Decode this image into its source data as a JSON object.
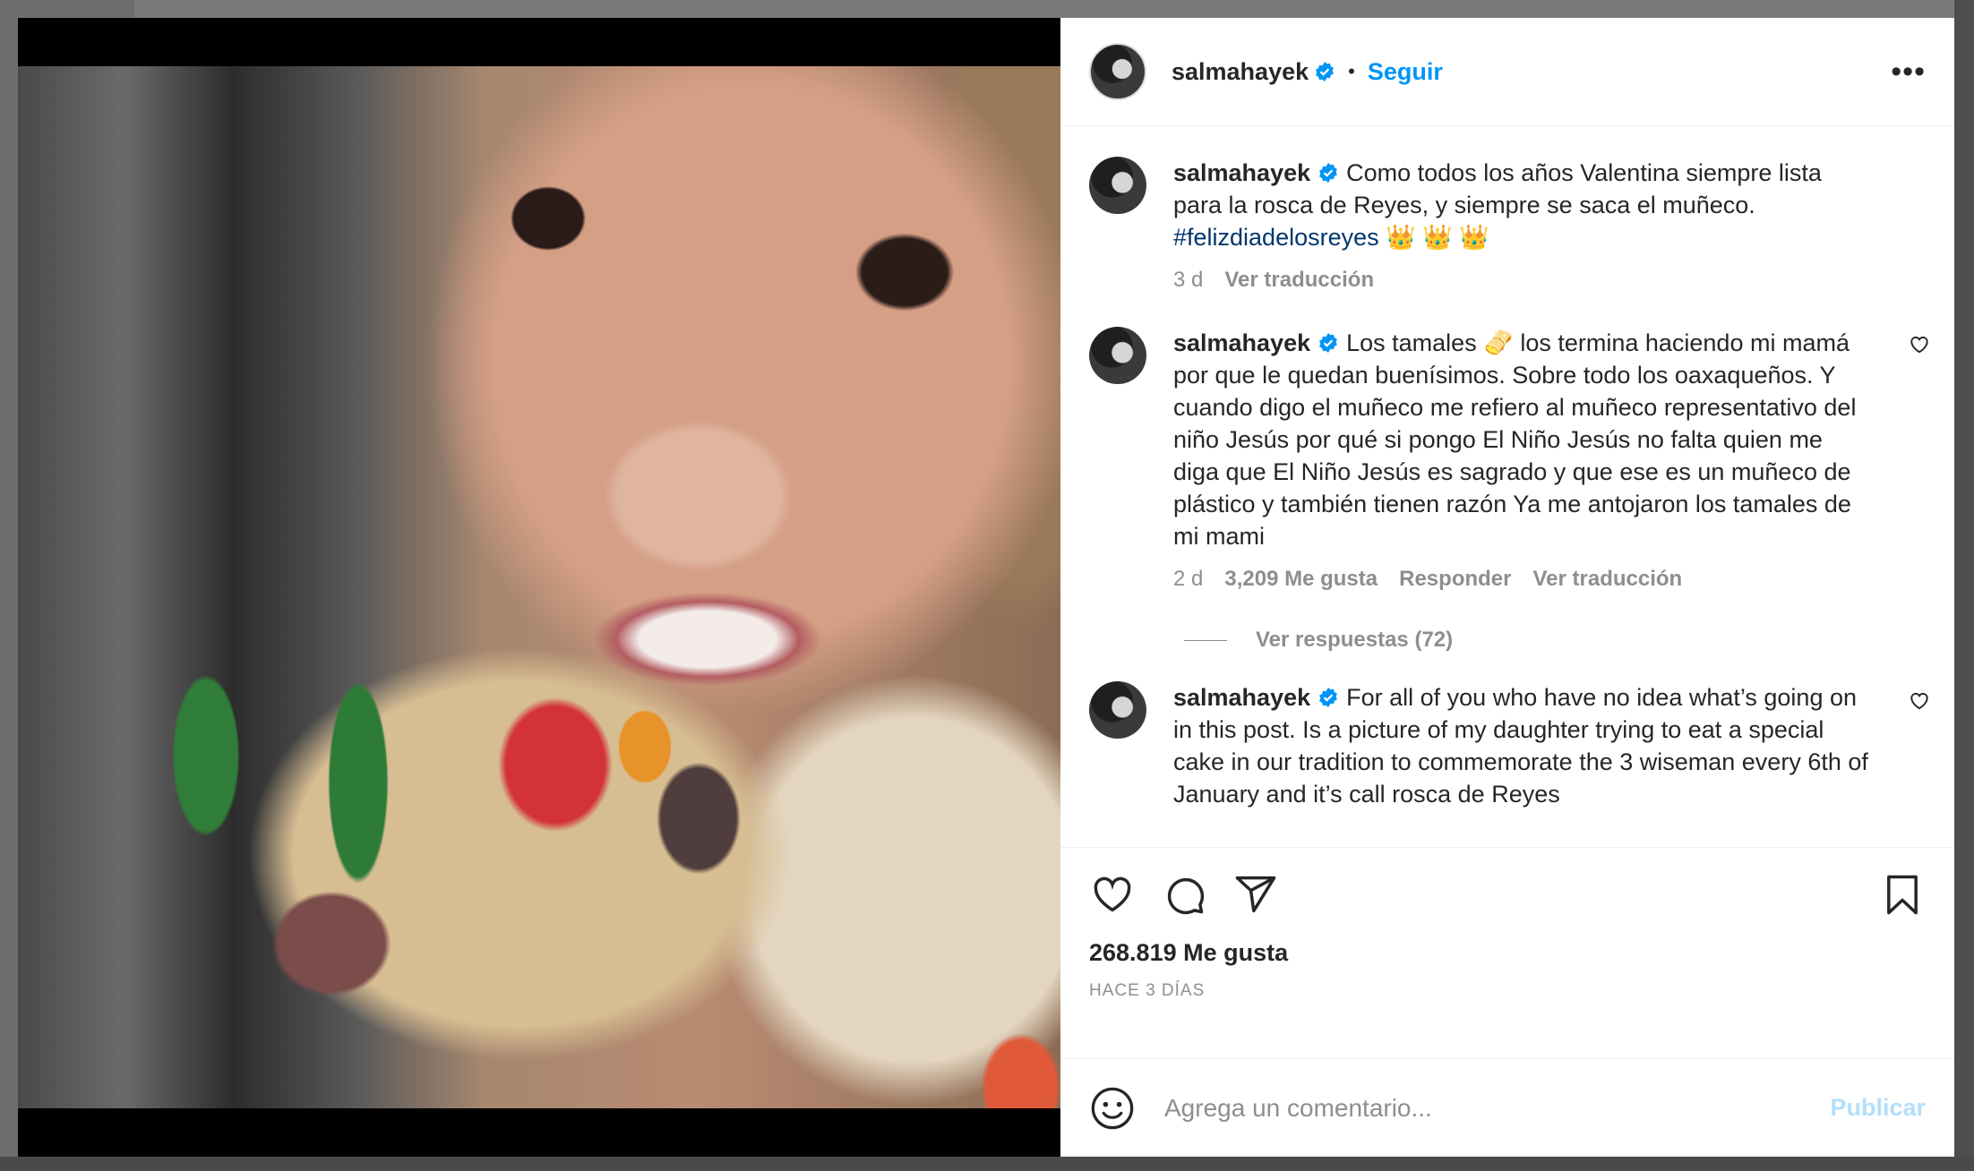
{
  "post": {
    "username": "salmahayek",
    "separator": "•",
    "follow_label": "Seguir",
    "more_label": "•••"
  },
  "caption": {
    "username": "salmahayek",
    "text": "Como todos los años Valentina siempre lista para la rosca de Reyes, y siempre se saca el muñeco.",
    "hashtag": "#felizdiadelosreyes",
    "emoji": "👑 👑 👑",
    "age": "3 d",
    "translate_label": "Ver traducción"
  },
  "comments": [
    {
      "username": "salmahayek",
      "text": "Los tamales 🫔 los termina haciendo mi mamá por que le quedan buenísimos. Sobre todo los oaxaqueños. Y cuando digo el muñeco me refiero al muñeco representativo del niño Jesús por qué si pongo El Niño Jesús no falta quien me diga que El Niño Jesús es sagrado y que ese es un muñeco de plástico y también tienen razón Ya me antojaron los tamales de mi mami",
      "age": "2 d",
      "likes": "3,209 Me gusta",
      "reply_label": "Responder",
      "translate_label": "Ver traducción",
      "replies_label": "Ver respuestas (72)"
    },
    {
      "username": "salmahayek",
      "text": "For all of you who have no idea what’s going on in this post. Is a picture of my daughter trying to eat a special cake in our tradition to commemorate the 3 wiseman every 6th of January and it’s call rosca de Reyes"
    }
  ],
  "stats": {
    "likes": "268.819 Me gusta",
    "date": "HACE 3 DÍAS"
  },
  "add_comment": {
    "placeholder": "Agrega un comentario...",
    "publish_label": "Publicar"
  },
  "colors": {
    "accent": "#0095f6",
    "hashtag": "#00376b",
    "muted": "#8e8e8e",
    "publish_disabled": "#b2dffc"
  }
}
